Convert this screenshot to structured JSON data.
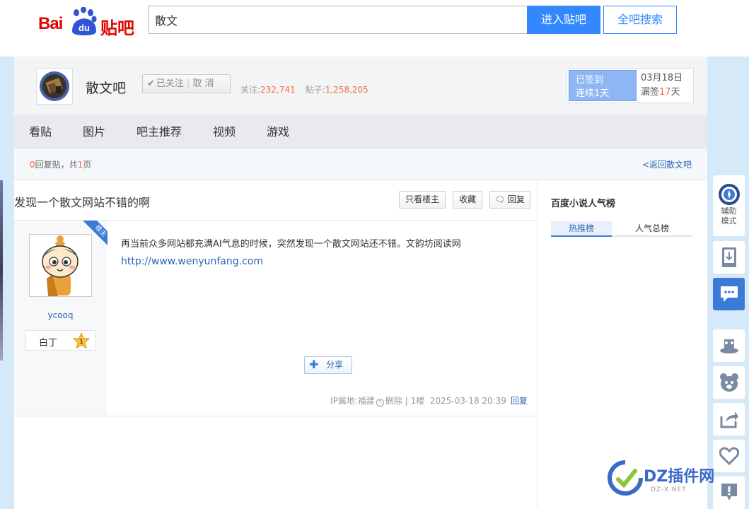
{
  "header": {
    "logo_latin": "Bai",
    "logo_paw": "du",
    "logo_cn": "贴吧",
    "search_value": "散文",
    "enter_button": "进入贴吧",
    "search_all_button": "全吧搜索"
  },
  "forum": {
    "name": "散文吧",
    "follow_status": "已关注",
    "unfollow": "取 消",
    "followers_label": "关注:",
    "followers": "232,741",
    "posts_label": "贴子:",
    "posts": "1,258,205",
    "signed_label": "已签到",
    "streak_label": "连续1天",
    "sign_date": "03月18日",
    "missed_prefix": "漏签",
    "missed_days": "17",
    "missed_suffix": "天"
  },
  "nav": {
    "items": [
      "看贴",
      "图片",
      "吧主推荐",
      "视频",
      "游戏"
    ]
  },
  "thread_bar": {
    "reply_count": "0",
    "reply_text": "回复贴，共",
    "pages": "1",
    "pages_suffix": "页",
    "back_link": "<返回散文吧"
  },
  "thread": {
    "title": "发现一个散文网站不错的啊",
    "btn_only_op": "只看楼主",
    "btn_collect": "收藏",
    "btn_reply": "回复"
  },
  "post": {
    "op_badge": "楼主",
    "author": "ycooq",
    "level_name": "白丁",
    "level_num": "1",
    "content_text": "再当前众多网站都充满AI气息的时候，突然发现一个散文网站还不错。文韵坊阅读网",
    "content_link": "http://www.wenyunfang.com",
    "share_label": "分享",
    "ip_location": "IP属地:福建",
    "delete_label": "删除",
    "floor": "1楼",
    "time": "2025-03-18 20:39",
    "reply_label": "回复"
  },
  "aside": {
    "title": "百度小说人气榜",
    "tab_hot": "热推榜",
    "tab_total": "人气总榜"
  },
  "toolbar": {
    "assist_label_1": "辅助",
    "assist_label_2": "模式",
    "icons": [
      "assist-icon",
      "app-download-icon",
      "feedback-icon",
      "magic-hat-icon",
      "bear-icon",
      "share-out-icon",
      "heart-icon",
      "report-icon"
    ]
  },
  "watermark": {
    "text": "DZ插件网",
    "sub": "DZ-X.NET"
  },
  "colors": {
    "brand_red": "#e10602",
    "brand_blue": "#3388ff",
    "link_blue": "#2d64b3",
    "accent_orange": "#f46b3f"
  }
}
